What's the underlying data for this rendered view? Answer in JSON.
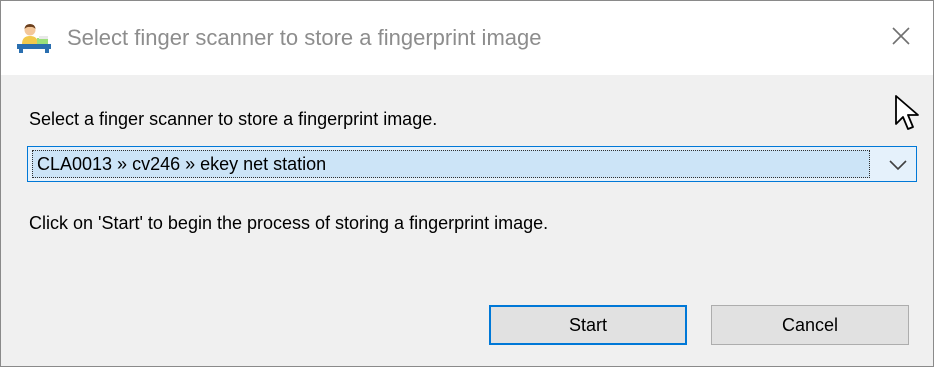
{
  "window": {
    "title": "Select finger scanner to store a fingerprint image",
    "icon": "user-app-icon",
    "close_icon": "close-icon"
  },
  "main": {
    "select_label": "Select a finger scanner to store a fingerprint image.",
    "scanner_select": {
      "selected": "CLA0013 » cv246 » ekey net station",
      "arrow_icon": "chevron-down-icon"
    },
    "instruction": "Click on 'Start' to begin the process of storing a fingerprint image."
  },
  "buttons": {
    "start_label": "Start",
    "cancel_label": "Cancel"
  },
  "colors": {
    "accent": "#0078d7",
    "combo_background": "#e5f1fb",
    "selection_background": "#cce4f7",
    "dialog_background": "#f0f0f0",
    "title_text": "#8d8d8d"
  }
}
